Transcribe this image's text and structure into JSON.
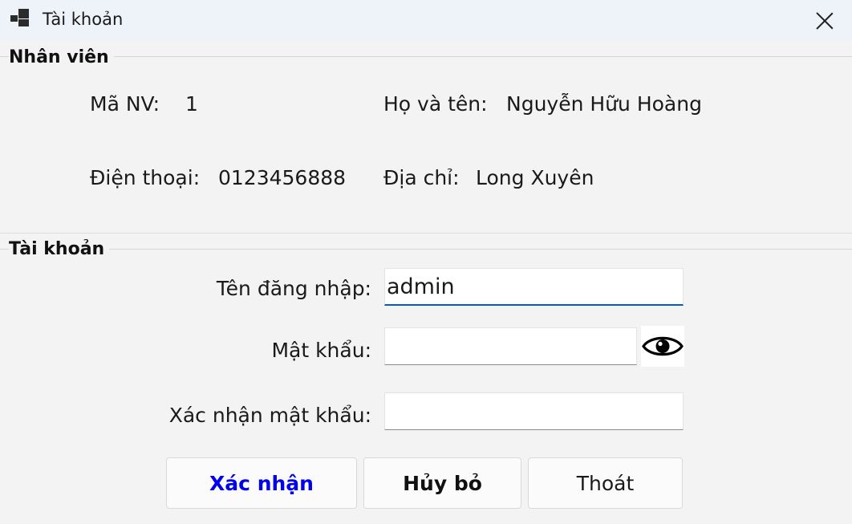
{
  "window": {
    "title": "Tài khoản"
  },
  "employee_group": {
    "title": "Nhân viên",
    "id_label": "Mã NV:",
    "id_value": "1",
    "name_label": "Họ và tên:",
    "name_value": "Nguyễn Hữu Hoàng",
    "phone_label": "Điện thoại:",
    "phone_value": "0123456888",
    "address_label": "Địa chỉ:",
    "address_value": "Long Xuyên"
  },
  "account_group": {
    "title": "Tài khoản",
    "username_label": "Tên đăng nhập:",
    "username_value": "admin",
    "password_label": "Mật khẩu:",
    "password_value": "",
    "confirm_label": "Xác nhận mật khẩu:",
    "confirm_value": ""
  },
  "buttons": {
    "confirm": "Xác nhận",
    "cancel": "Hủy bỏ",
    "exit": "Thoát"
  },
  "colors": {
    "confirm_text": "#0000ee",
    "focus_underline": "#005fb8"
  },
  "icons": {
    "app": "app-window-icon",
    "close": "close-icon",
    "show_password": "eye-icon"
  }
}
